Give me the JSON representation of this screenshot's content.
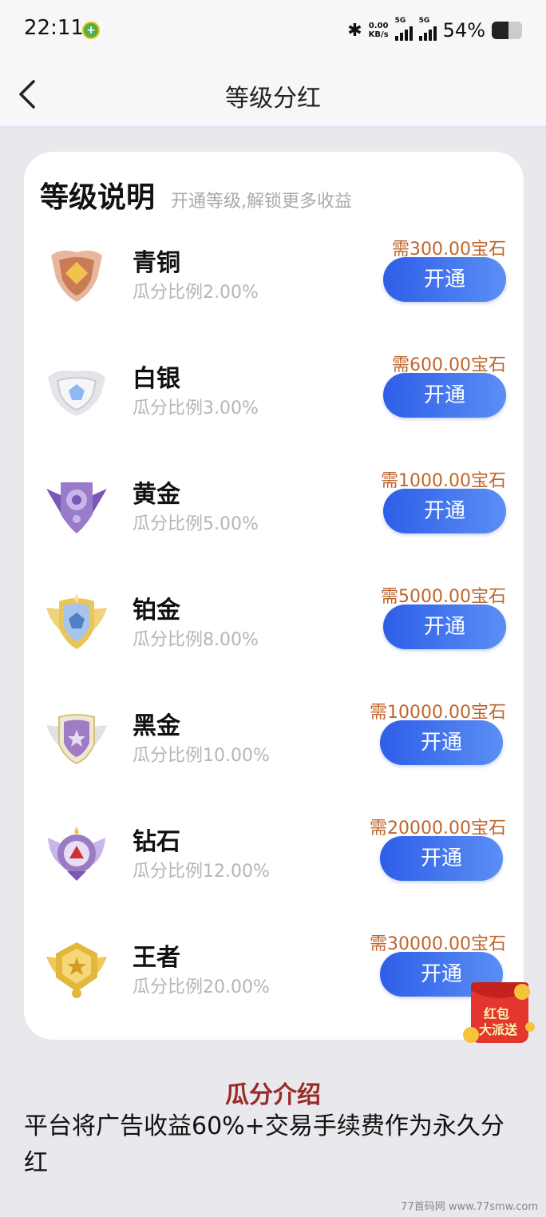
{
  "status_bar": {
    "time": "22:11",
    "speed_value": "0.00",
    "speed_unit": "KB/s",
    "signal1_label": "5G",
    "signal2_label": "5G",
    "battery": "54%",
    "battery_level": 0.54
  },
  "nav": {
    "title": "等级分红",
    "back_icon": "chevron-left-icon"
  },
  "card": {
    "title": "等级说明",
    "subtitle": "开通等级,解锁更多收益"
  },
  "levels": [
    {
      "name": "青铜",
      "ratio": "瓜分比例2.00%",
      "price": "需300.00宝石",
      "button": "开通",
      "badge_color": "#d9936c"
    },
    {
      "name": "白银",
      "ratio": "瓜分比例3.00%",
      "price": "需600.00宝石",
      "button": "开通",
      "badge_color": "#d9dce3"
    },
    {
      "name": "黄金",
      "ratio": "瓜分比例5.00%",
      "price": "需1000.00宝石",
      "button": "开通",
      "badge_color": "#9a7bc9"
    },
    {
      "name": "铂金",
      "ratio": "瓜分比例8.00%",
      "price": "需5000.00宝石",
      "button": "开通",
      "badge_color": "#e8c65a"
    },
    {
      "name": "黑金",
      "ratio": "瓜分比例10.00%",
      "price": "需10000.00宝石",
      "button": "开通",
      "badge_color": "#a07cc7"
    },
    {
      "name": "钻石",
      "ratio": "瓜分比例12.00%",
      "price": "需20000.00宝石",
      "button": "开通",
      "badge_color": "#9b7cc2"
    },
    {
      "name": "王者",
      "ratio": "瓜分比例20.00%",
      "price": "需30000.00宝石",
      "button": "开通",
      "badge_color": "#e3b73a"
    }
  ],
  "red_packet": {
    "line1": "红包",
    "line2": "大派送"
  },
  "intro": {
    "title": "瓜分介绍",
    "text": "平台将广告收益60%+交易手续费作为永久分红"
  },
  "watermark": "77首码网 www.77smw.com"
}
